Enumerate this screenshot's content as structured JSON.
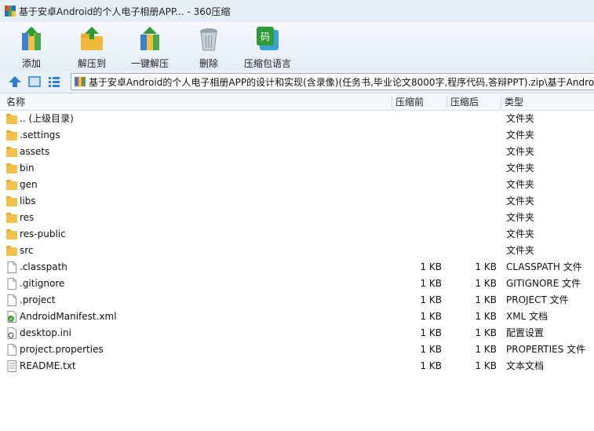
{
  "window": {
    "title": "基于安卓Android的个人电子相册APP... - 360压缩"
  },
  "toolbar": {
    "add": "添加",
    "extract_to": "解压到",
    "one_click_extract": "一键解压",
    "delete": "删除",
    "language": "压缩包语言"
  },
  "address": {
    "path": "基于安卓Android的个人电子相册APP的设计和实现(含录像)(任务书,毕业论文8000字,程序代码,答辩PPT).zip\\基于Android的"
  },
  "columns": {
    "name": "名称",
    "size_before": "压缩前",
    "size_after": "压缩后",
    "type": "类型"
  },
  "files": [
    {
      "icon": "folder",
      "name": ".. (上级目录)",
      "before": "",
      "after": "",
      "type": "文件夹"
    },
    {
      "icon": "folder",
      "name": ".settings",
      "before": "",
      "after": "",
      "type": "文件夹"
    },
    {
      "icon": "folder",
      "name": "assets",
      "before": "",
      "after": "",
      "type": "文件夹"
    },
    {
      "icon": "folder",
      "name": "bin",
      "before": "",
      "after": "",
      "type": "文件夹"
    },
    {
      "icon": "folder",
      "name": "gen",
      "before": "",
      "after": "",
      "type": "文件夹"
    },
    {
      "icon": "folder",
      "name": "libs",
      "before": "",
      "after": "",
      "type": "文件夹"
    },
    {
      "icon": "folder",
      "name": "res",
      "before": "",
      "after": "",
      "type": "文件夹"
    },
    {
      "icon": "folder",
      "name": "res-public",
      "before": "",
      "after": "",
      "type": "文件夹"
    },
    {
      "icon": "folder",
      "name": "src",
      "before": "",
      "after": "",
      "type": "文件夹"
    },
    {
      "icon": "file",
      "name": ".classpath",
      "before": "1 KB",
      "after": "1 KB",
      "type": "CLASSPATH 文件"
    },
    {
      "icon": "file",
      "name": ".gitignore",
      "before": "1 KB",
      "after": "1 KB",
      "type": "GITIGNORE 文件"
    },
    {
      "icon": "file",
      "name": ".project",
      "before": "1 KB",
      "after": "1 KB",
      "type": "PROJECT 文件"
    },
    {
      "icon": "xml",
      "name": "AndroidManifest.xml",
      "before": "1 KB",
      "after": "1 KB",
      "type": "XML 文档"
    },
    {
      "icon": "ini",
      "name": "desktop.ini",
      "before": "1 KB",
      "after": "1 KB",
      "type": "配置设置"
    },
    {
      "icon": "file",
      "name": "project.properties",
      "before": "1 KB",
      "after": "1 KB",
      "type": "PROPERTIES 文件"
    },
    {
      "icon": "txt",
      "name": "README.txt",
      "before": "1 KB",
      "after": "1 KB",
      "type": "文本文档"
    }
  ]
}
